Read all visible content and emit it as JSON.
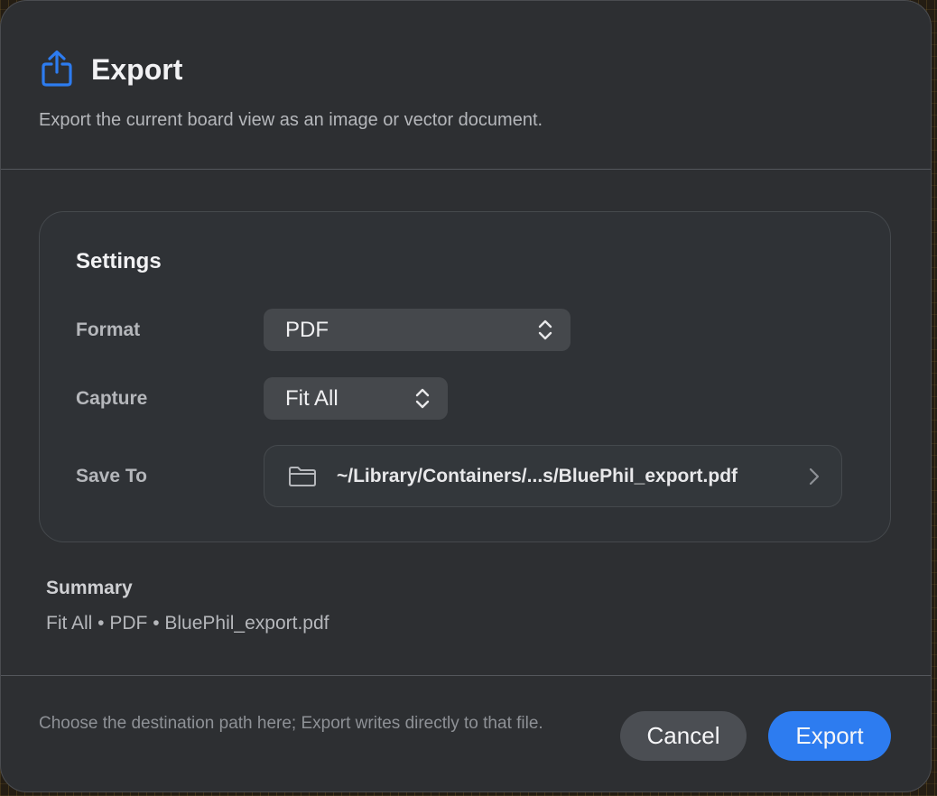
{
  "dialog": {
    "title": "Export",
    "subtitle": "Export the current board view as an image or vector document.",
    "icon": "share-export-icon",
    "accent_color": "#2d7cf0"
  },
  "settings": {
    "heading": "Settings",
    "format": {
      "label": "Format",
      "value": "PDF"
    },
    "capture": {
      "label": "Capture",
      "value": "Fit All"
    },
    "save_to": {
      "label": "Save To",
      "path": "~/Library/Containers/...s/BluePhil_export.pdf",
      "icon": "folder-icon"
    }
  },
  "summary": {
    "label": "Summary",
    "text": "Fit All • PDF • BluePhil_export.pdf"
  },
  "footer": {
    "note": "Choose the destination path here; Export writes directly to that file.",
    "cancel_label": "Cancel",
    "export_label": "Export"
  }
}
